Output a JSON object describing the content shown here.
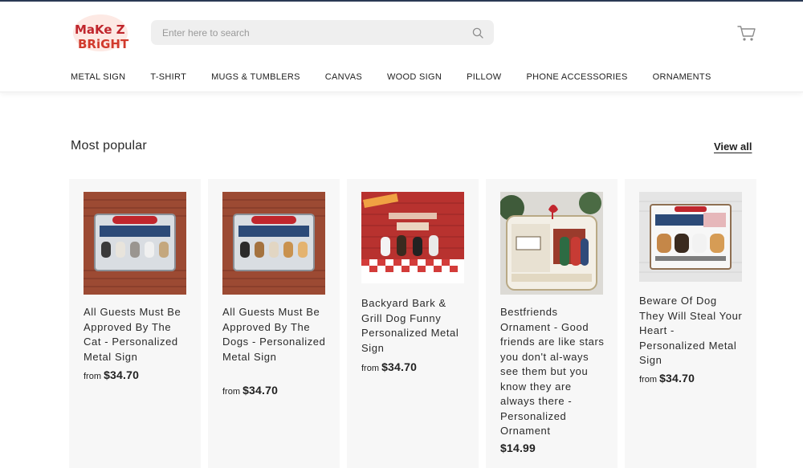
{
  "brand": {
    "logo_line1": "MaKe Z",
    "logo_line2": "BRiGHT"
  },
  "search": {
    "placeholder": "Enter here to search"
  },
  "nav": [
    "METAL SIGN",
    "T-SHIRT",
    "MUGS & TUMBLERS",
    "CANVAS",
    "WOOD SIGN",
    "PILLOW",
    "PHONE ACCESSORIES",
    "ORNAMENTS"
  ],
  "section": {
    "title": "Most popular",
    "view_all": "View all"
  },
  "products": [
    {
      "name": "All Guests Must Be Approved By The Cat - Personalized Metal Sign",
      "price_prefix": "from",
      "price": "$34.70"
    },
    {
      "name": "All Guests Must Be Approved By The Dogs - Personalized Metal Sign",
      "price_prefix": "from",
      "price": "$34.70"
    },
    {
      "name": "Backyard Bark & Grill Dog Funny Personalized Metal Sign",
      "price_prefix": "from",
      "price": "$34.70"
    },
    {
      "name": "Bestfriends Ornament - Good friends are like stars you don't al-ways see them but you know they are always there - Personalized Ornament",
      "price_prefix": "",
      "price": "$14.99"
    },
    {
      "name": "Beware Of Dog They Will Steal Your Heart - Personalized Metal Sign",
      "price_prefix": "from",
      "price": "$34.70"
    }
  ],
  "colors": {
    "accent_nav_rule": "#2b3a55",
    "logo_red": "#c0262d",
    "card_bg": "#f7f7f7"
  }
}
